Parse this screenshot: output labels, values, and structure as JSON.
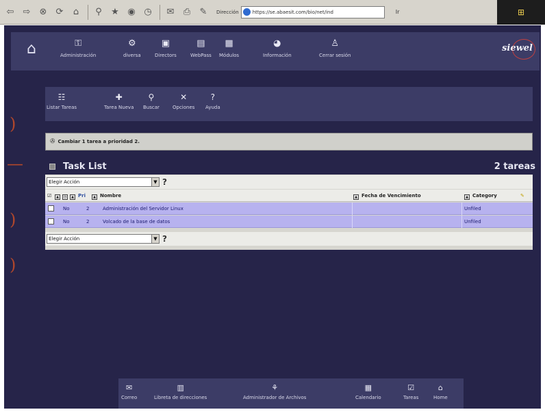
{
  "browser": {
    "address_label": "Dirección",
    "address_value": "https://se.abaesit.com/bio/net/ind",
    "go_label": "Ir"
  },
  "topnav": {
    "brand": "siewel",
    "items": [
      {
        "label": "Administración",
        "icon": "admin-icon"
      },
      {
        "label": "diversa",
        "icon": "tools-icon"
      },
      {
        "label": "Directors",
        "icon": "directory-icon"
      },
      {
        "label": "WebPass",
        "icon": "webpass-icon"
      },
      {
        "label": "Módulos",
        "icon": "modules-icon"
      },
      {
        "label": "Información",
        "icon": "info-icon"
      },
      {
        "label": "Cerrar sesión",
        "icon": "logout-icon"
      }
    ]
  },
  "subnav": {
    "items": [
      {
        "label": "Listar Tareas",
        "icon": "list-tasks-icon"
      },
      {
        "label": "Tarea Nueva",
        "icon": "new-task-icon"
      },
      {
        "label": "Buscar",
        "icon": "search-icon"
      },
      {
        "label": "Opciones",
        "icon": "options-icon"
      },
      {
        "label": "Ayuda",
        "icon": "help-icon"
      }
    ]
  },
  "message": "Cambiar 1 tarea a prioridad 2.",
  "task_list": {
    "title": "Task List",
    "count": "2 tareas",
    "action_select": "Elegir Acción",
    "help": "?",
    "columns": {
      "pri": "Pri",
      "name": "Nombre",
      "due": "Fecha de Vencimiento",
      "category": "Category"
    },
    "rows": [
      {
        "status": "No",
        "priority": "2",
        "name": "Administración del Servidor Linux",
        "due": "",
        "category": "Unfiled"
      },
      {
        "status": "No",
        "priority": "2",
        "name": "Volcado de la base de datos",
        "due": "",
        "category": "Unfiled"
      }
    ]
  },
  "dock": {
    "items": [
      {
        "label": "Correo",
        "icon": "mail-icon"
      },
      {
        "label": "Libreta de direcciones",
        "icon": "addressbook-icon"
      },
      {
        "label": "Administrador de Archivos",
        "icon": "filemanager-icon"
      },
      {
        "label": "Calendario",
        "icon": "calendar-icon"
      },
      {
        "label": "Tareas",
        "icon": "tasks-icon"
      },
      {
        "label": "Home",
        "icon": "home-icon"
      }
    ]
  }
}
